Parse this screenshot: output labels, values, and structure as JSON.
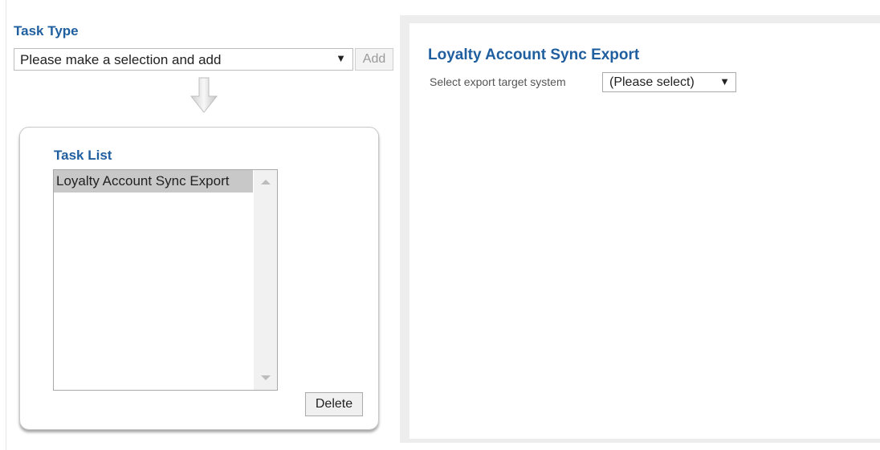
{
  "task_type": {
    "title": "Task Type",
    "select_value": "Please make a selection and add",
    "add_label": "Add"
  },
  "task_list": {
    "title": "Task List",
    "items": [
      "Loyalty Account Sync Export"
    ],
    "selected_index": 0,
    "delete_label": "Delete"
  },
  "export_panel": {
    "title": "Loyalty Account Sync Export",
    "target_label": "Select export target system",
    "target_value": "(Please select)"
  },
  "icons": {
    "dropdown": "▼",
    "flow_arrow": "arrow-down-icon"
  },
  "colors": {
    "heading": "#1f5f9f",
    "selected_item": "#c8c8c8",
    "frame": "#ededed"
  }
}
